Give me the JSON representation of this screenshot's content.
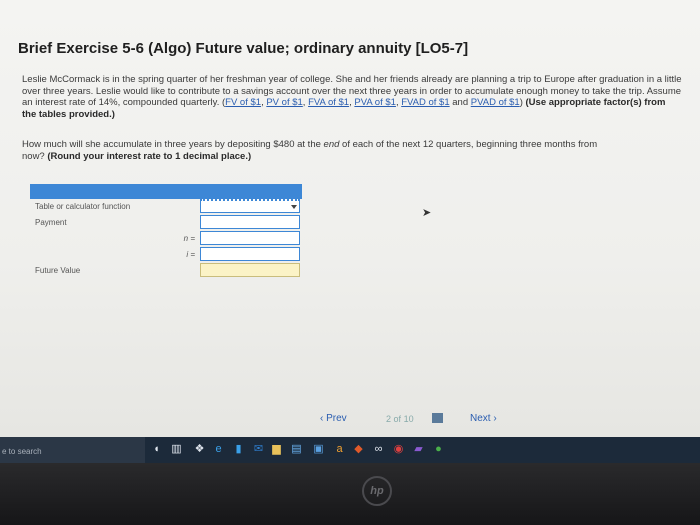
{
  "title": "Brief Exercise 5-6 (Algo) Future value; ordinary annuity [LO5-7]",
  "problem": {
    "text_a": "Leslie McCormack is in the spring quarter of her freshman year of college. She and her friends already are planning a trip to Europe after graduation in a little over three years. Leslie would like to contribute to a savings account over the next three years in order to accumulate enough money to take the trip. Assume an interest rate of 14%, compounded quarterly. (",
    "links": [
      "FV of $1",
      "PV of $1",
      "FVA of $1",
      "PVA of $1",
      "FVAD of $1",
      "PVAD of $1"
    ],
    "text_and": " and ",
    "text_close": ")",
    "instruction": "(Use appropriate factor(s) from the tables provided.)"
  },
  "question": {
    "text_a": "How much will she accumulate in three years by depositing $480 at the ",
    "italic": "end",
    "text_b": " of each of the next 12 quarters, beginning three months from now? ",
    "bold": "(Round your interest rate to 1 decimal place.)"
  },
  "table": {
    "rows": [
      {
        "label": "Table or calculator function",
        "caption": "",
        "value": ""
      },
      {
        "label": "Payment",
        "caption": "",
        "value": ""
      },
      {
        "label": "",
        "caption": "n =",
        "value": ""
      },
      {
        "label": "",
        "caption": "i =",
        "value": ""
      },
      {
        "label": "Future Value",
        "caption": "",
        "value": ""
      }
    ]
  },
  "nav": {
    "prev": "‹  Prev",
    "page_current": "2",
    "page_of": "of",
    "page_total": "10",
    "next": "Next  ›"
  },
  "taskbar": {
    "search_placeholder": "e to search"
  },
  "bezel": {
    "logo": "hp"
  },
  "colors": {
    "accent": "#3d87d6",
    "link": "#2a5db0",
    "answer_yellow": "#fbf3c6"
  }
}
